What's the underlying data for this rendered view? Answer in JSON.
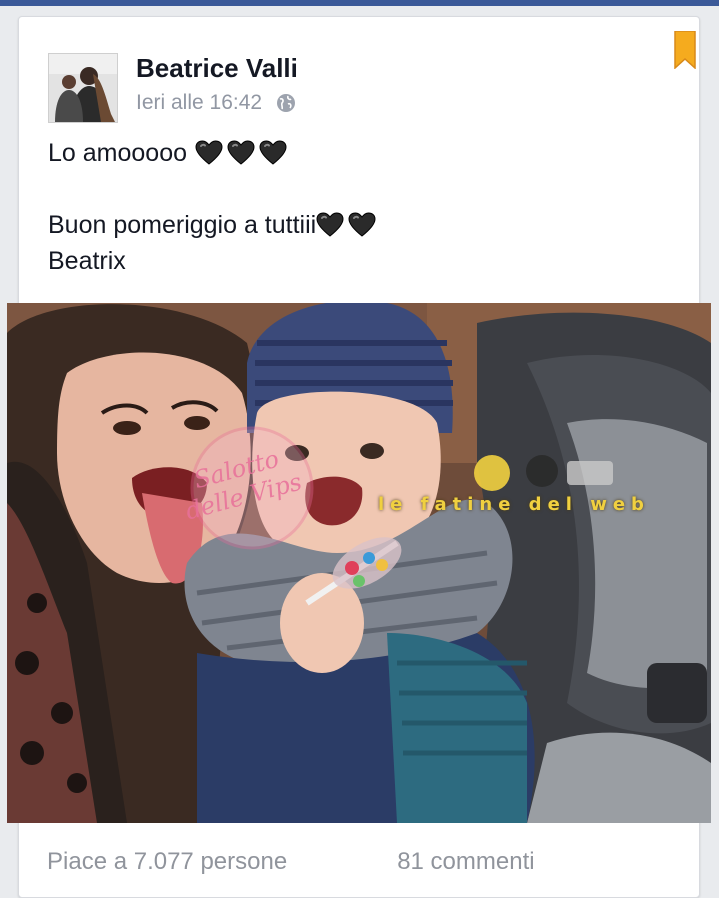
{
  "post": {
    "author": "Beatrice Valli",
    "timestamp": "Ieri alle 16:42",
    "privacy_icon": "globe-icon",
    "bookmark_icon": "bookmark-icon",
    "text_line1": "Lo amooooo",
    "text_line2": "Buon pomeriggio a tuttiii",
    "text_line3": "Beatrix",
    "emoji_line1": [
      "black-heart",
      "black-heart",
      "black-heart"
    ],
    "emoji_line2": [
      "black-heart",
      "black-heart"
    ]
  },
  "photo": {
    "watermark_left": "Salotto delle Vips",
    "watermark_right": "le fatine del web"
  },
  "footer": {
    "likes": "Piace a 7.077 persone",
    "comments": "81 commenti"
  },
  "colors": {
    "brand": "#3b5998",
    "bookmark": "#f7b731",
    "text": "#141823",
    "meta": "#9197a3"
  }
}
